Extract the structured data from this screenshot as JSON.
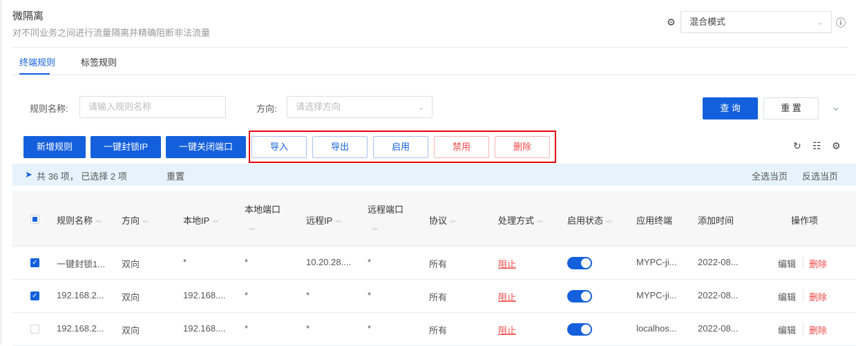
{
  "header": {
    "title": "微隔离",
    "subtitle": "对不同业务之间进行流量隔离并精确阻断非法流量",
    "mode_select": "混合模式"
  },
  "tabs": [
    {
      "label": "终端规则",
      "active": true
    },
    {
      "label": "标签规则",
      "active": false
    }
  ],
  "filters": {
    "name_label": "规则名称:",
    "name_placeholder": "请输入规则名称",
    "direction_label": "方向:",
    "direction_placeholder": "请选择方向",
    "query": "查 询",
    "reset": "重 置"
  },
  "toolbar": {
    "add": "新增规则",
    "block_ip": "一键封锁IP",
    "close_port": "一键关闭端口",
    "import": "导入",
    "export": "导出",
    "enable": "启用",
    "disable": "禁用",
    "delete": "删除"
  },
  "selection": {
    "summary": "共 36 项， 已选择 2 项",
    "reset": "重置",
    "select_page": "全选当页",
    "invert_page": "反选当页"
  },
  "columns": [
    "规则名称",
    "方向",
    "本地IP",
    "本地端口",
    "远程IP",
    "远程端口",
    "协议",
    "处理方式",
    "启用状态",
    "应用终端",
    "添加时间",
    "操作项"
  ],
  "rows": [
    {
      "checked": true,
      "name": "一键封锁1...",
      "direction": "双向",
      "local_ip": "*",
      "local_port": "*",
      "remote_ip": "10.20.28....",
      "remote_port": "*",
      "protocol": "所有",
      "action": "阻止",
      "enabled": true,
      "terminal": "MYPC-ji...",
      "time": "2022-08...",
      "edit": "编辑",
      "delete": "删除"
    },
    {
      "checked": true,
      "name": "192.168.2...",
      "direction": "双向",
      "local_ip": "192.168....",
      "local_port": "*",
      "remote_ip": "*",
      "remote_port": "*",
      "protocol": "所有",
      "action": "阻止",
      "enabled": true,
      "terminal": "MYPC-ji...",
      "time": "2022-08...",
      "edit": "编辑",
      "delete": "删除"
    },
    {
      "checked": false,
      "name": "192.168.2...",
      "direction": "双向",
      "local_ip": "192.168....",
      "local_port": "*",
      "remote_ip": "*",
      "remote_port": "*",
      "protocol": "所有",
      "action": "阻止",
      "enabled": true,
      "terminal": "localhos...",
      "time": "2022-08...",
      "edit": "编辑",
      "delete": "删除"
    }
  ]
}
